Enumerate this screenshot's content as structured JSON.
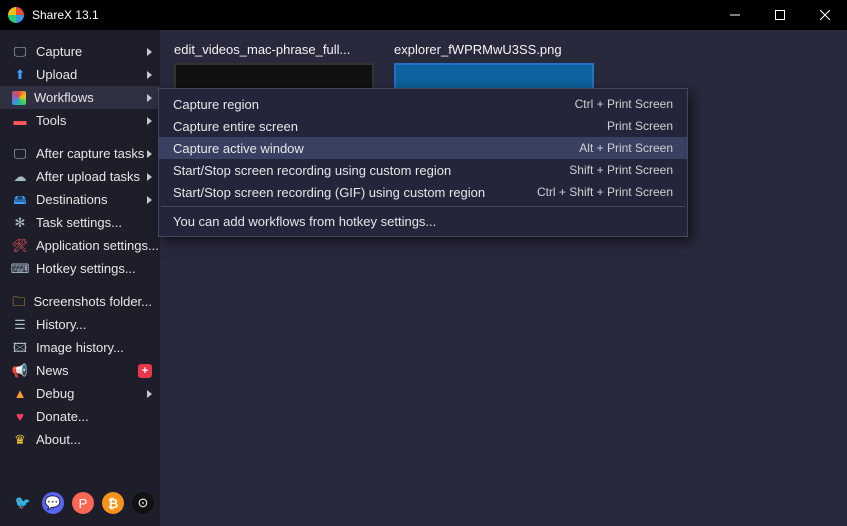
{
  "window": {
    "title": "ShareX 13.1",
    "minimize": "—",
    "maximize": "▢",
    "close": "✕"
  },
  "sidebar": {
    "items": [
      {
        "label": "Capture",
        "icon": "🖵",
        "iconClass": "c-gray",
        "arrow": true
      },
      {
        "label": "Upload",
        "icon": "⬆",
        "iconClass": "c-blue",
        "arrow": true
      },
      {
        "label": "Workflows",
        "icon": "⛭",
        "iconClass": "",
        "arrow": true,
        "highlight": true,
        "rainbow": true
      },
      {
        "label": "Tools",
        "icon": "▬",
        "iconClass": "c-red",
        "arrow": true
      },
      {
        "label": "After capture tasks",
        "icon": "🖵",
        "iconClass": "c-gray",
        "arrow": true,
        "sep": true
      },
      {
        "label": "After upload tasks",
        "icon": "☁",
        "iconClass": "c-gray",
        "arrow": true
      },
      {
        "label": "Destinations",
        "icon": "🖴",
        "iconClass": "c-blue",
        "arrow": true
      },
      {
        "label": "Task settings...",
        "icon": "✻",
        "iconClass": "c-gray"
      },
      {
        "label": "Application settings...",
        "icon": "🛠",
        "iconClass": "c-red"
      },
      {
        "label": "Hotkey settings...",
        "icon": "⌨",
        "iconClass": "c-gray"
      },
      {
        "label": "Screenshots folder...",
        "icon": "🗀",
        "iconClass": "c-yellow",
        "sep": true
      },
      {
        "label": "History...",
        "icon": "☰",
        "iconClass": "c-gray"
      },
      {
        "label": "Image history...",
        "icon": "🖾",
        "iconClass": "c-gray"
      },
      {
        "label": "News",
        "icon": "📢",
        "iconClass": "c-red",
        "badge": "+"
      },
      {
        "label": "Debug",
        "icon": "▲",
        "iconClass": "c-orange",
        "arrow": true
      },
      {
        "label": "Donate...",
        "icon": "♥",
        "iconClass": "c-pink"
      },
      {
        "label": "About...",
        "icon": "♛",
        "iconClass": "c-yellow"
      }
    ]
  },
  "flyout": {
    "items": [
      {
        "label": "Capture region",
        "shortcut": "Ctrl + Print Screen"
      },
      {
        "label": "Capture entire screen",
        "shortcut": "Print Screen"
      },
      {
        "label": "Capture active window",
        "shortcut": "Alt + Print Screen",
        "hover": true
      },
      {
        "label": "Start/Stop screen recording using custom region",
        "shortcut": "Shift + Print Screen"
      },
      {
        "label": "Start/Stop screen recording (GIF) using custom region",
        "shortcut": "Ctrl + Shift + Print Screen"
      }
    ],
    "footer": "You can add workflows from hotkey settings..."
  },
  "thumbs": [
    {
      "filename": "edit_videos_mac-phrase_full...",
      "dark": true
    },
    {
      "filename": "explorer_fWPRMwU3SS.png",
      "dark": false
    }
  ],
  "social": {
    "twitter": "🐦",
    "discord": "💬",
    "patreon": "P",
    "bitcoin": "₿",
    "github": "⊙"
  }
}
